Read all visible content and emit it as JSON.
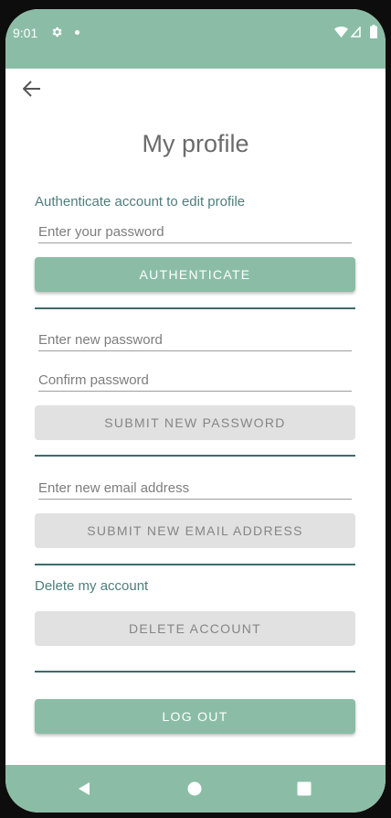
{
  "status_bar": {
    "time": "9:01",
    "icons": [
      "settings-icon",
      "notification-dot-icon",
      "wifi-icon",
      "signal-icon",
      "battery-icon"
    ]
  },
  "header": {
    "back_icon": "arrow-back-icon",
    "title": "My profile"
  },
  "authenticate": {
    "label": "Authenticate account to edit profile",
    "password_placeholder": "Enter your password",
    "button_label": "AUTHENTICATE"
  },
  "change_password": {
    "new_password_placeholder": "Enter new password",
    "confirm_password_placeholder": "Confirm password",
    "button_label": "SUBMIT NEW PASSWORD"
  },
  "change_email": {
    "email_placeholder": "Enter new email address",
    "button_label": "SUBMIT NEW EMAIL ADDRESS"
  },
  "delete_account": {
    "label": "Delete my account",
    "button_label": "DELETE ACCOUNT"
  },
  "logout": {
    "button_label": "LOG OUT"
  },
  "nav_bar": {
    "icons": [
      "nav-back-icon",
      "nav-home-icon",
      "nav-recents-icon"
    ]
  },
  "colors": {
    "accent": "#8bbda6",
    "label_text": "#4f7d7c",
    "divider": "#3f6b6a",
    "disabled_button": "#e1e1e1",
    "disabled_text": "#858585"
  }
}
